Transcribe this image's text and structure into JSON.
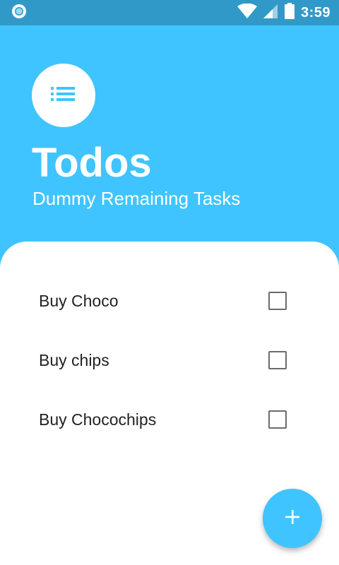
{
  "status_bar": {
    "time": "3:59",
    "icons": [
      "app-notification-icon",
      "wifi-icon",
      "cell-signal-icon",
      "battery-icon"
    ]
  },
  "header": {
    "icon": "list-icon",
    "title": "Todos",
    "subtitle": "Dummy Remaining Tasks"
  },
  "tasks": [
    {
      "label": "Buy Choco",
      "checked": false
    },
    {
      "label": "Buy chips",
      "checked": false
    },
    {
      "label": "Buy Chocochips",
      "checked": false
    }
  ],
  "fab": {
    "icon": "add-icon"
  },
  "colors": {
    "primary": "#40c4ff",
    "status_bar": "#3199c8",
    "surface": "#ffffff"
  }
}
